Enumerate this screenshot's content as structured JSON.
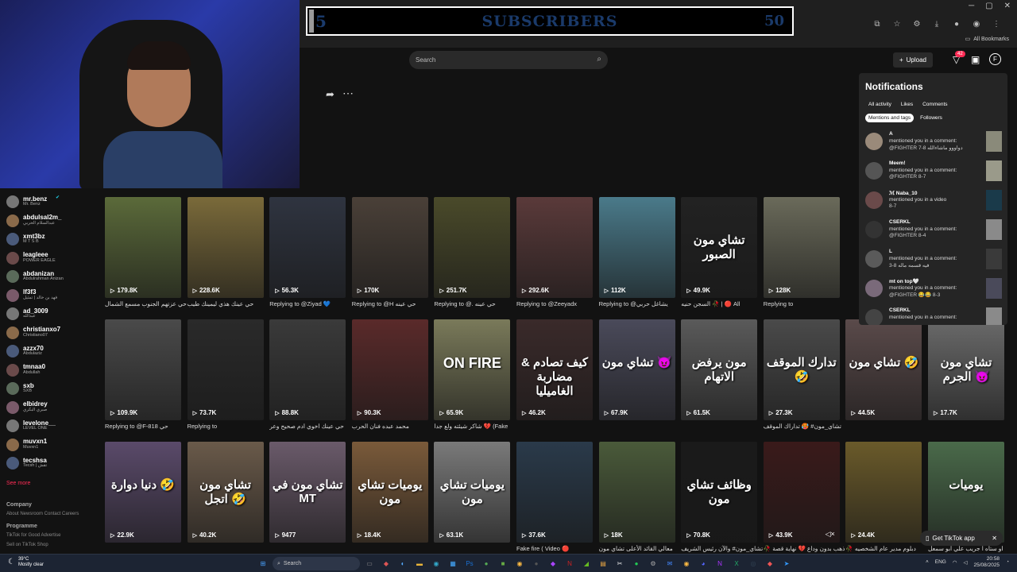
{
  "browser": {
    "window_controls": [
      "─",
      "▢",
      "✕"
    ],
    "bookmarks_label": "All Bookmarks"
  },
  "subscribers": {
    "current": "5",
    "label": "SUBSCRIBERS",
    "goal": "50",
    "progress_fraction": 0.1
  },
  "header": {
    "search_placeholder": "Search",
    "upload_label": "Upload",
    "inbox_count": "42"
  },
  "sidebar": {
    "accounts": [
      {
        "name": "mr.benz",
        "sub": "Mr. Benz",
        "verified": true
      },
      {
        "name": "abdulsal2m_",
        "sub": "عبدالسلام الحربي"
      },
      {
        "name": "xmt3bz",
        "sub": "M T S B"
      },
      {
        "name": "leagleee",
        "sub": "POWER EAGLE"
      },
      {
        "name": "abdanizan",
        "sub": "Abdulrahman Anizan"
      },
      {
        "name": "lf3f3",
        "sub": "فهد بن خالد | تمثيل"
      },
      {
        "name": "ad_3009",
        "sub": "عبدالله"
      },
      {
        "name": "christianxo7",
        "sub": "Christiano07"
      },
      {
        "name": "azzx70",
        "sub": "Abdulaziz"
      },
      {
        "name": "tmnaa0",
        "sub": "Abdullah"
      },
      {
        "name": "sxb",
        "sub": "SXB"
      },
      {
        "name": "elbidrey",
        "sub": "صبري البكري"
      },
      {
        "name": "levelone__",
        "sub": "LEVEL ONE"
      },
      {
        "name": "muvxn1",
        "sub": "Muvxn1"
      },
      {
        "name": "tecshsa",
        "sub": "Tecsh | تقش"
      }
    ],
    "see_more": "See more",
    "footer": {
      "company": "Company",
      "company_links": "About  Newsroom  Contact  Careers",
      "programme": "Programme",
      "programme_links_1": "TikTok for Good  Advertise",
      "programme_links_2": "Sell on TikTok Shop"
    }
  },
  "videos": {
    "row1": [
      {
        "views": "179.8K",
        "caption": "حي عزتهم الجنوب مسمع الشمال",
        "color": "#5b6a3a",
        "overlay": ""
      },
      {
        "views": "228.6K",
        "caption": "حي عينك هذي ليمينك طيب",
        "color": "#7a6a3a",
        "overlay": ""
      },
      {
        "views": "56.3K",
        "caption": "Replying to @Ziyad 💙",
        "color": "#2f3440",
        "overlay": ""
      },
      {
        "views": "170K",
        "caption": "Replying to @H حي عينه",
        "color": "#4a4038",
        "overlay": ""
      },
      {
        "views": "251.7K",
        "caption": "Replying to @. حي عينه",
        "color": "#4a4a2a",
        "overlay": ""
      },
      {
        "views": "292.6K",
        "caption": "Replying to @Zeeyadx",
        "color": "#5a3a3a",
        "overlay": ""
      },
      {
        "views": "112K",
        "caption": "Replying to @يشاغل حربي",
        "color": "#4a7a8a",
        "overlay": ""
      },
      {
        "views": "49.9K",
        "caption": "السجن حنيه 🥀 | 🔴 All",
        "color": "#222222",
        "overlay": "تشاي مون الصبور"
      },
      {
        "views": "128K",
        "caption": "Replying to",
        "color": "#6a6a5a",
        "overlay": ""
      }
    ],
    "row2": [
      {
        "views": "109.9K",
        "caption": "Replying to @F-818 حي",
        "color": "#4a4a4a",
        "overlay": ""
      },
      {
        "views": "73.7K",
        "caption": "Replying to",
        "color": "#2a2a2a",
        "overlay": ""
      },
      {
        "views": "88.8K",
        "caption": "حي عينك اخوي ادم صحيح وعر",
        "color": "#3a3a3a",
        "overlay": ""
      },
      {
        "views": "90.3K",
        "caption": "محمد عبده فنان الحرب",
        "color": "#5a2a2a",
        "overlay": ""
      },
      {
        "views": "65.9K",
        "caption": "شاكر شيئته ولع جدا 💔 (Fake",
        "color": "#7a7a5a",
        "overlay": "ON FIRE"
      },
      {
        "views": "46.2K",
        "caption": "",
        "color": "#3a2a2a",
        "overlay": "كيف تصادم & مضاربة الغاميليا"
      },
      {
        "views": "67.9K",
        "caption": "",
        "color": "#4a4a5a",
        "overlay": "تشاي مون 😈"
      },
      {
        "views": "61.5K",
        "caption": "",
        "color": "#5a5a5a",
        "overlay": "مون يرفض الاتهام"
      },
      {
        "views": "27.3K",
        "caption": "تشاي_مون# 🥵 تداراك الموقف",
        "color": "#4a4a4a",
        "overlay": "تدارك الموقف 🤣"
      },
      {
        "views": "44.5K",
        "caption": "",
        "color": "#5a4a4a",
        "overlay": "تشاي مون 🤣"
      },
      {
        "views": "17.7K",
        "caption": "",
        "color": "#6a6a6a",
        "overlay": "تشاي مون الجرم 😈"
      }
    ],
    "row3": [
      {
        "views": "22.9K",
        "caption": "",
        "color": "#5a4a6a",
        "overlay": "دنيا دوارة 🤣"
      },
      {
        "views": "40.2K",
        "caption": "",
        "color": "#6a5a4a",
        "overlay": "تشاي مون اتجل 🤣"
      },
      {
        "views": "9477",
        "caption": "",
        "color": "#6a5a6a",
        "overlay": "تشاي مون في MT"
      },
      {
        "views": "18.4K",
        "caption": "",
        "color": "#7a5a3a",
        "overlay": "يوميات تشاي مون"
      },
      {
        "views": "63.1K",
        "caption": "",
        "color": "#7a7a7a",
        "overlay": "يوميات تشاي مون"
      },
      {
        "views": "37.6K",
        "caption": "Fake fire ( Video 🔴",
        "color": "#2a3a4a",
        "overlay": ""
      },
      {
        "views": "18K",
        "caption": "معالي القائد الأعلى تشاي مون",
        "color": "#4a5a3a",
        "overlay": ""
      },
      {
        "views": "70.8K",
        "caption": "تشاي_مون# والآن رئيس الشريف",
        "color": "#1a1a1a",
        "overlay": "وظائف تشاي مون"
      },
      {
        "views": "43.9K",
        "caption": "🥀 ذهب بدون وداع 💔 نهاية قصة",
        "color": "#3a1a1a",
        "overlay": ""
      },
      {
        "views": "24.4K",
        "caption": "🥀 دبلوم مدير عام الشخصيه",
        "color": "#6a5a2a",
        "overlay": ""
      },
      {
        "views": "",
        "caption": "او ستاه ا جريب علي ابو سمعل",
        "color": "#4a6a4a",
        "overlay": "يوميات"
      }
    ]
  },
  "notifications": {
    "title": "Notifications",
    "tabs": [
      "All activity",
      "Likes",
      "Comments"
    ],
    "tabs2": [
      "Mentions and tags",
      "Followers"
    ],
    "active_tab": "Mentions and tags",
    "items": [
      {
        "name": "A",
        "action": "mentioned you in a comment:",
        "detail": "@FIGHTER دواووو ماشاءالله 8-7"
      },
      {
        "name": "Meem!",
        "action": "mentioned you in a comment:",
        "detail": "@FIGHTER 8-7"
      },
      {
        "name": "ℳ Naba_10",
        "action": "mentioned you in a video",
        "detail": "8-7"
      },
      {
        "name": "CSERKL",
        "action": "mentioned you in a comment:",
        "detail": "@FIGHTER 8-4"
      },
      {
        "name": "L",
        "action": "mentioned you in a comment:",
        "detail": "فيه قسمه ماله 8-3"
      },
      {
        "name": "mt on top🤍",
        "action": "mentioned you in a comment:",
        "detail": "@FIGHTER 😂😂 8-3"
      },
      {
        "name": "CSERKL",
        "action": "mentioned you in a comment:",
        "detail": ""
      }
    ]
  },
  "get_app": "Get TikTok app",
  "taskbar": {
    "temp": "39°C",
    "weather": "Mostly clear",
    "search": "Search",
    "lang": "ENG",
    "time": "20:58",
    "date": "25/08/2025"
  }
}
